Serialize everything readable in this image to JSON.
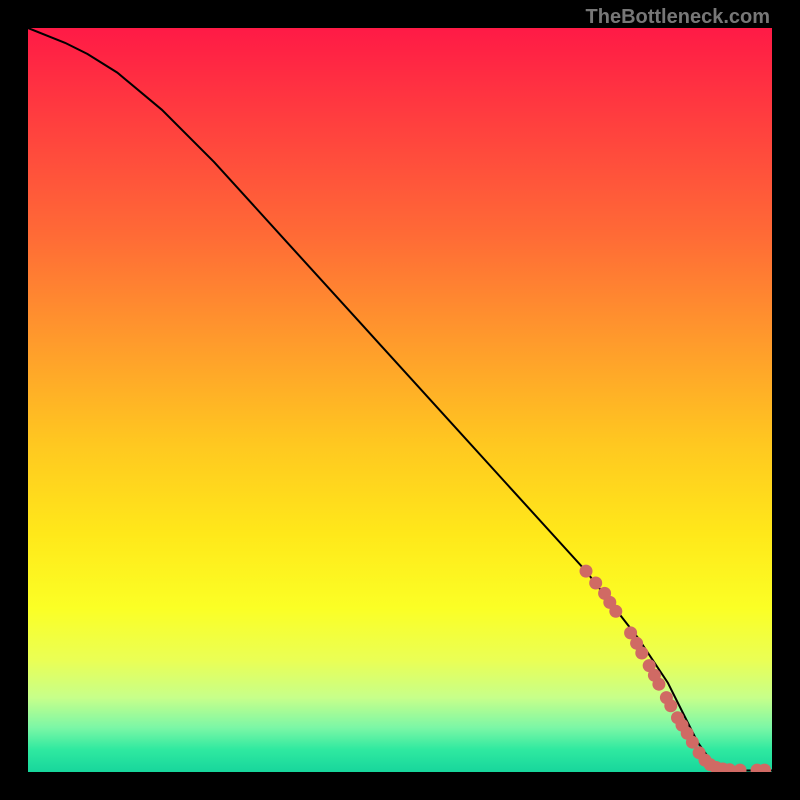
{
  "watermark": "TheBottleneck.com",
  "chart_data": {
    "type": "line",
    "title": "",
    "xlabel": "",
    "ylabel": "",
    "xlim": [
      0,
      100
    ],
    "ylim": [
      0,
      100
    ],
    "series": [
      {
        "name": "curve",
        "x": [
          0,
          5,
          8,
          12,
          18,
          25,
          35,
          45,
          55,
          65,
          75,
          82,
          86,
          88,
          90,
          92,
          94,
          96,
          98,
          100
        ],
        "y": [
          100,
          98,
          96.5,
          94,
          89,
          82,
          71,
          60,
          49,
          38,
          27,
          18,
          12,
          8,
          4,
          1.2,
          0.4,
          0.2,
          0.2,
          0.2
        ]
      }
    ],
    "markers": [
      {
        "x": 75.0,
        "y": 27.0
      },
      {
        "x": 76.3,
        "y": 25.4
      },
      {
        "x": 77.5,
        "y": 24.0
      },
      {
        "x": 78.2,
        "y": 22.8
      },
      {
        "x": 79.0,
        "y": 21.6
      },
      {
        "x": 81.0,
        "y": 18.7
      },
      {
        "x": 81.8,
        "y": 17.3
      },
      {
        "x": 82.5,
        "y": 16.0
      },
      {
        "x": 83.5,
        "y": 14.3
      },
      {
        "x": 84.2,
        "y": 13.0
      },
      {
        "x": 84.8,
        "y": 11.8
      },
      {
        "x": 85.8,
        "y": 10.0
      },
      {
        "x": 86.4,
        "y": 8.9
      },
      {
        "x": 87.3,
        "y": 7.3
      },
      {
        "x": 87.9,
        "y": 6.3
      },
      {
        "x": 88.6,
        "y": 5.2
      },
      {
        "x": 89.3,
        "y": 4.0
      },
      {
        "x": 90.2,
        "y": 2.6
      },
      {
        "x": 91.0,
        "y": 1.6
      },
      {
        "x": 91.7,
        "y": 1.0
      },
      {
        "x": 92.5,
        "y": 0.6
      },
      {
        "x": 93.4,
        "y": 0.4
      },
      {
        "x": 94.3,
        "y": 0.3
      },
      {
        "x": 95.7,
        "y": 0.25
      },
      {
        "x": 98.0,
        "y": 0.25
      },
      {
        "x": 99.0,
        "y": 0.25
      }
    ],
    "marker_color": "#d06a64",
    "curve_color": "#000000"
  }
}
